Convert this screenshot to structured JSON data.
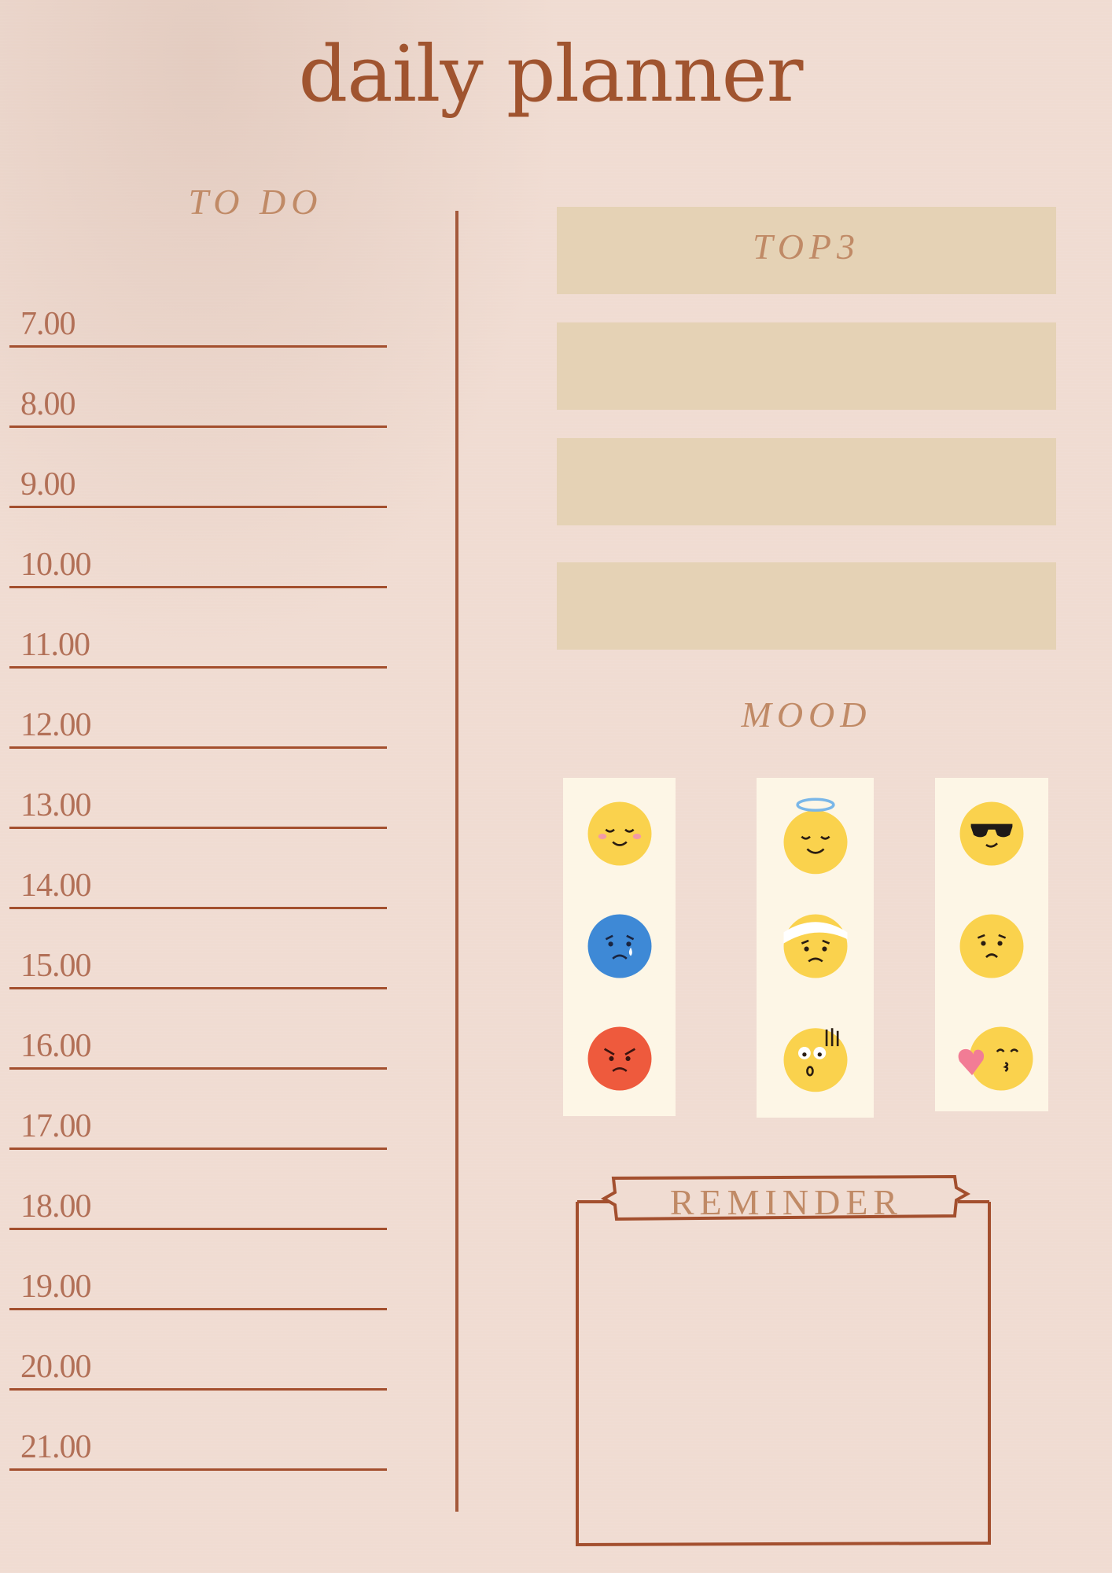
{
  "title": "daily planner",
  "todo": {
    "label": "TO DO",
    "times": [
      "7.00",
      "8.00",
      "9.00",
      "10.00",
      "11.00",
      "12.00",
      "13.00",
      "14.00",
      "15.00",
      "16.00",
      "17.00",
      "18.00",
      "19.00",
      "20.00",
      "21.00"
    ]
  },
  "top3": {
    "label": "TOP3"
  },
  "mood": {
    "label": "MOOD",
    "faces": [
      [
        "smiling-blush-icon",
        "sad-tear-icon",
        "angry-icon"
      ],
      [
        "angel-halo-icon",
        "bandaged-face-icon",
        "shocked-face-icon"
      ],
      [
        "sunglasses-cool-icon",
        "worried-face-icon",
        "kiss-heart-icon"
      ]
    ]
  },
  "reminder": {
    "label": "REMINDER"
  },
  "colors": {
    "background": "#f0dcd2",
    "accent": "#a0542f",
    "box": "#e5d2b5",
    "mood_card": "#fdf6e6",
    "yellow_face": "#fad24d",
    "blue_face": "#3e89d6",
    "red_face": "#ee5a3d"
  }
}
